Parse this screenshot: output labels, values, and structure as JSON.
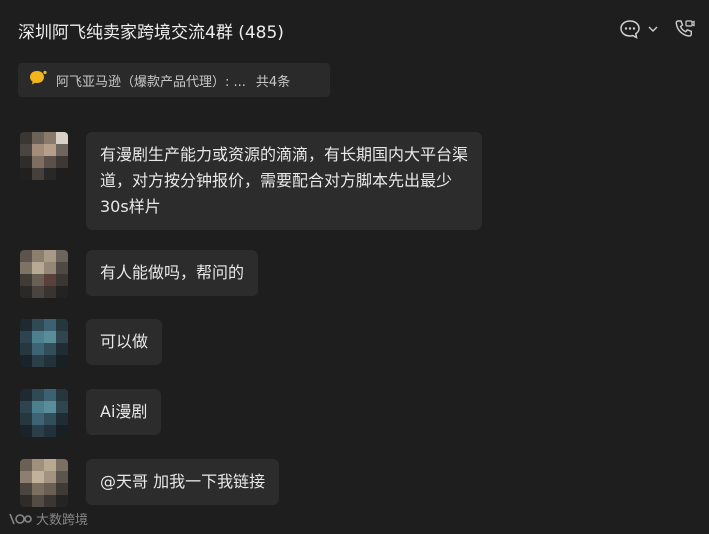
{
  "header": {
    "title": "深圳阿飞纯卖家跨境交流4群 (485)"
  },
  "pinned": {
    "text": "阿飞亚马逊（爆款产品代理）: ...",
    "count": "共4条"
  },
  "messages": [
    {
      "text": "有漫剧生产能力或资源的滴滴，有长期国内大平台渠道，对方按分钟报价，需要配合对方脚本先出最少30s样片"
    },
    {
      "text": "有人能做吗，帮问的"
    },
    {
      "text": "可以做"
    },
    {
      "text": "Ai漫剧"
    },
    {
      "text": "@天哥 加我一下我链接"
    }
  ],
  "watermark": {
    "text": "大数跨境"
  }
}
